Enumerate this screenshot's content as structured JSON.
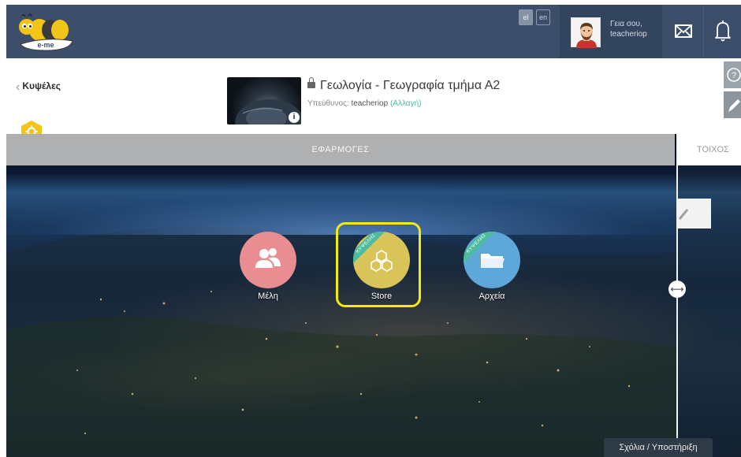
{
  "header": {
    "logo_text": "e-me",
    "languages": [
      "el",
      "en"
    ],
    "greeting_line1": "Γεια σου,",
    "username": "teacheriop"
  },
  "group": {
    "back_label": "Κυψέλες",
    "title": "Γεωλογία - Γεωγραφία τμήμα Α2",
    "owner_prefix": "Υπεύθυνος:",
    "owner": "teacheriop",
    "change_label": "(Αλλαγή)",
    "info_badge": "i"
  },
  "main": {
    "apps_bar_label": "ΕΦΑΡΜΟΓΕΣ",
    "wall_label": "ΤΟΙΧΟΣ",
    "apps": [
      {
        "label": "Μέλη",
        "color": "#e88e93",
        "icon": "users-icon"
      },
      {
        "label": "Store",
        "color": "#d9c45a",
        "icon": "honeycomb-icon",
        "ribbon": "ΚΥΨΕΛΗΣ"
      },
      {
        "label": "Αρχεία",
        "color": "#5ea8d9",
        "icon": "folder-icon",
        "ribbon": "ΚΥΨΕΛΗΣ"
      }
    ],
    "highlight_color": "#f3ea10"
  },
  "footer": {
    "feedback_label": "Σχόλια / Υποστήριξη"
  },
  "colors": {
    "header_bg": "#3c4e69",
    "accent_green": "#4dbb9f",
    "hex_yellow": "#f5c419"
  }
}
